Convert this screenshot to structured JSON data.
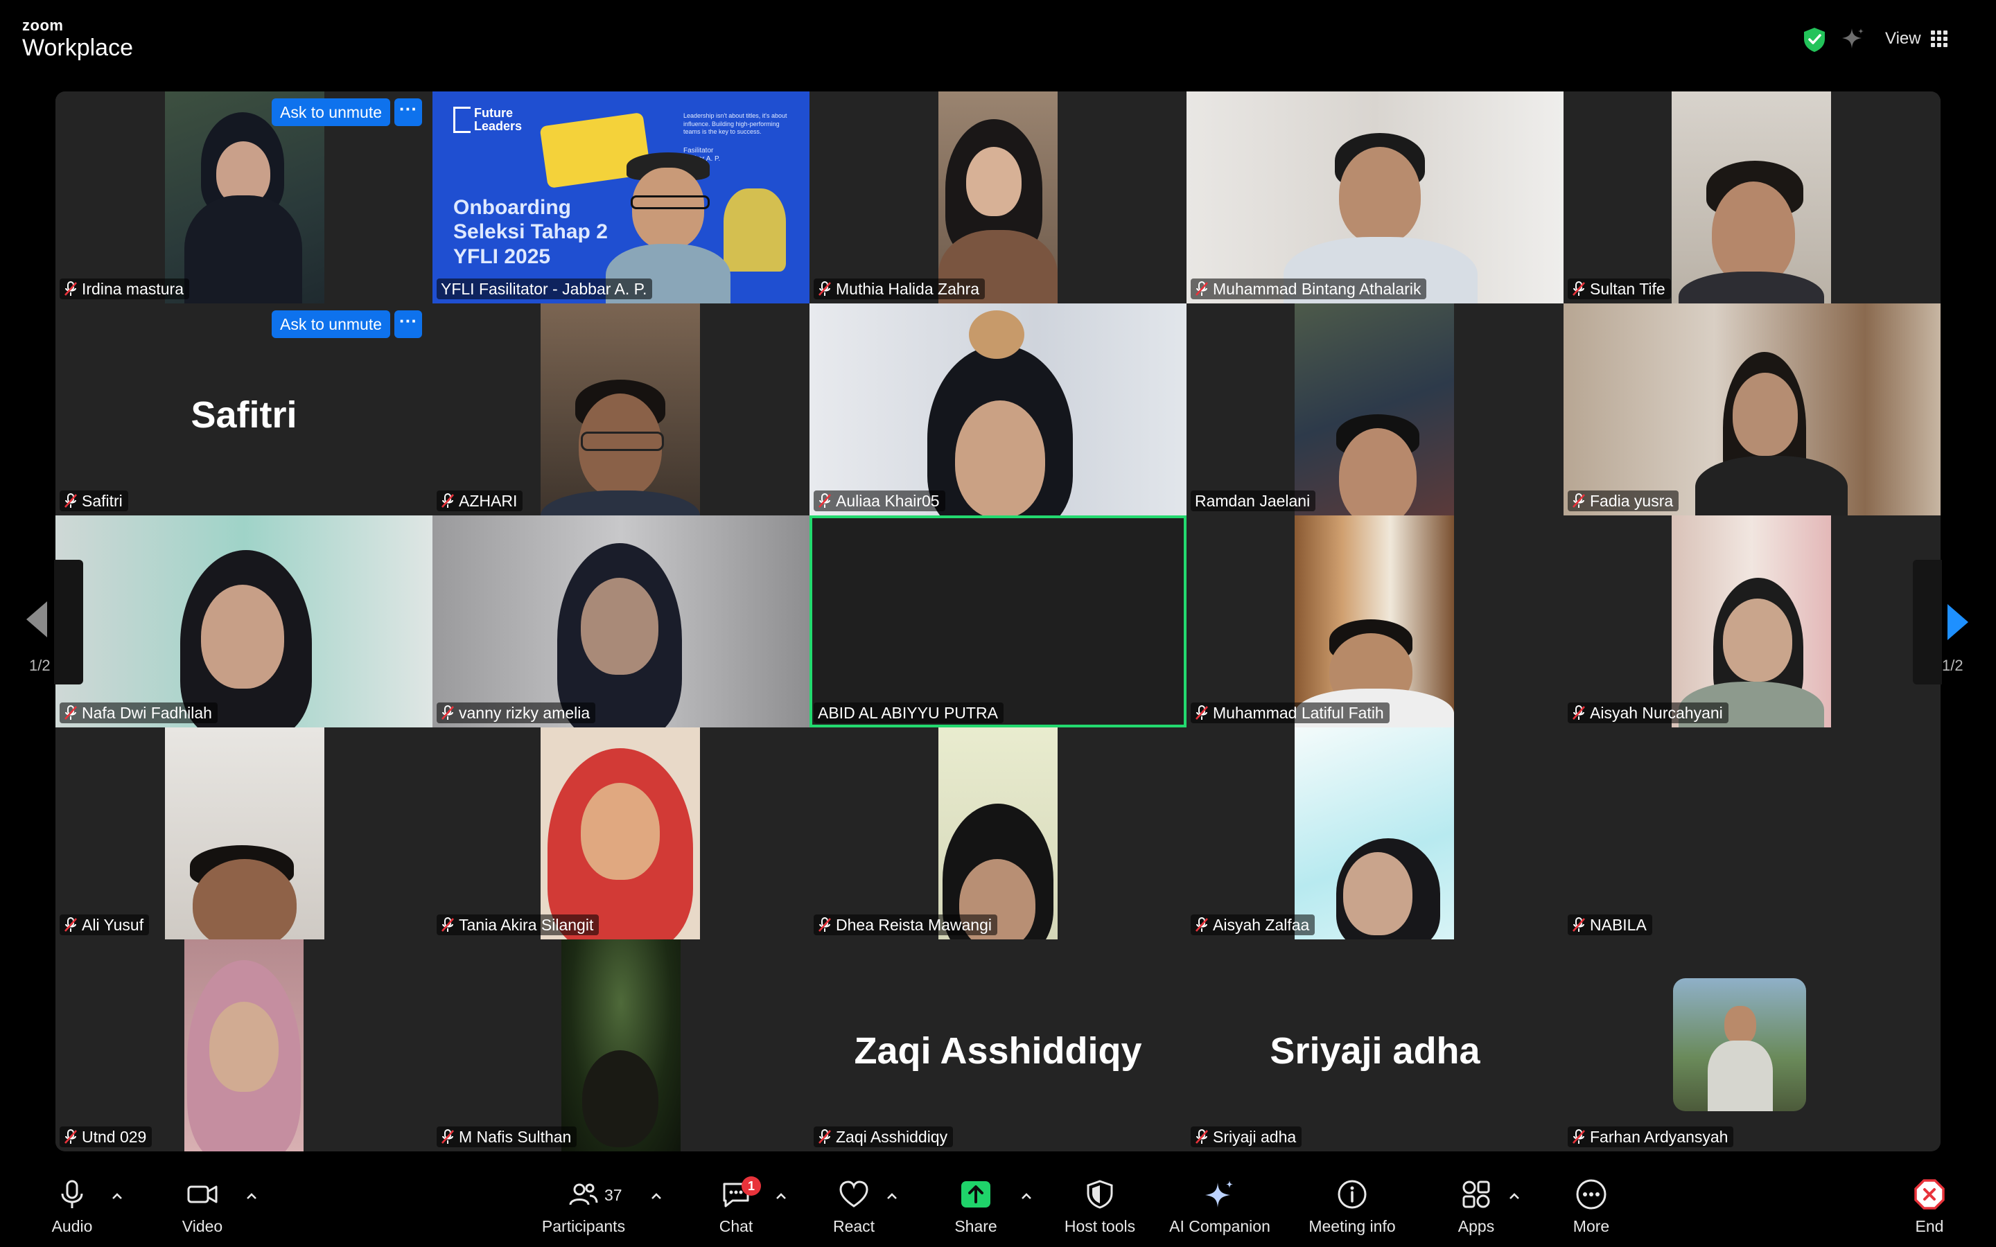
{
  "app": {
    "brand_small": "zoom",
    "brand_big": "Workplace"
  },
  "header": {
    "view_label": "View"
  },
  "pagination": {
    "left_label": "1/2",
    "right_label": "1/2"
  },
  "unmute": {
    "label": "Ask to unmute",
    "more": "···"
  },
  "tiles": [
    {
      "name": "Irdina mastura",
      "muted": true
    },
    {
      "name": "YFLI Fasilitator - Jabbar A. P.",
      "muted": false
    },
    {
      "name": "Muthia Halida Zahra",
      "muted": true
    },
    {
      "name": "Muhammad Bintang Athalarik",
      "muted": true
    },
    {
      "name": "Sultan Tife",
      "muted": true
    },
    {
      "name": "Safitri",
      "muted": true,
      "big_name": "Safitri"
    },
    {
      "name": "AZHARI",
      "muted": true
    },
    {
      "name": "Auliaa Khair05",
      "muted": true
    },
    {
      "name": "Ramdan Jaelani",
      "muted": false
    },
    {
      "name": "Fadia yusra",
      "muted": true
    },
    {
      "name": "Nafa Dwi Fadhilah",
      "muted": true
    },
    {
      "name": "vanny rizky amelia",
      "muted": true
    },
    {
      "name": "ABID AL ABIYYU PUTRA",
      "muted": false
    },
    {
      "name": "Muhammad Latiful Fatih",
      "muted": true
    },
    {
      "name": "Aisyah Nurcahyani",
      "muted": true
    },
    {
      "name": "Ali Yusuf",
      "muted": true
    },
    {
      "name": "Tania Akira Silangit",
      "muted": true
    },
    {
      "name": "Dhea Reista Mawangi",
      "muted": true
    },
    {
      "name": "Aisyah Zalfaa",
      "muted": true
    },
    {
      "name": "NABILA",
      "muted": true
    },
    {
      "name": "Utnd 029",
      "muted": true
    },
    {
      "name": "M Nafis Sulthan",
      "muted": true
    },
    {
      "name": "Zaqi Asshiddiqy",
      "muted": true,
      "big_name": "Zaqi Asshiddiqy"
    },
    {
      "name": "Sriyaji adha",
      "muted": true,
      "big_name": "Sriyaji adha"
    },
    {
      "name": "Farhan Ardyansyah",
      "muted": true
    }
  ],
  "slide": {
    "logo": "Future\nLeaders",
    "title_lines": [
      "Onboarding",
      "Seleksi Tahap 2",
      "YFLI 2025"
    ],
    "desc": "Leadership isn't about titles, it's about influence. Building high-performing teams is the key to success.",
    "facilitator_label": "Fasilitator",
    "facilitator_name": "Jabbar A. P."
  },
  "toolbar": {
    "audio": "Audio",
    "video": "Video",
    "participants": "Participants",
    "participants_count": "37",
    "chat": "Chat",
    "chat_badge": "1",
    "react": "React",
    "share": "Share",
    "host_tools": "Host tools",
    "ai_companion": "AI Companion",
    "meeting_info": "Meeting info",
    "apps": "Apps",
    "more": "More",
    "end": "End"
  },
  "colors": {
    "accent": "#0e72ed",
    "active_speaker": "#23d96f",
    "share_green": "#1fd36a",
    "end_red": "#e8333b",
    "muted_red": "#e8333b"
  }
}
